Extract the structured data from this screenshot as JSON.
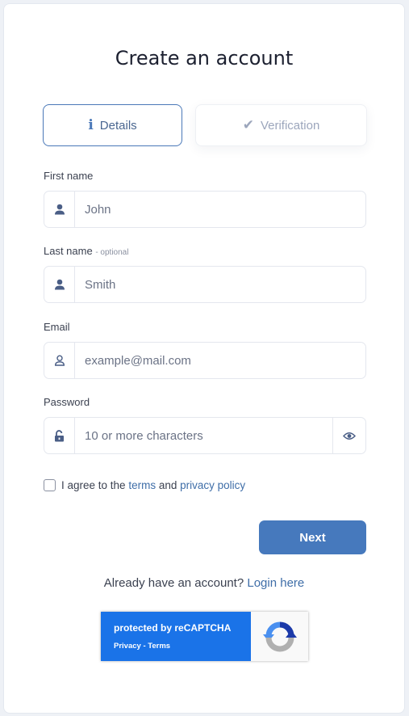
{
  "page": {
    "title": "Create an account"
  },
  "tabs": [
    {
      "label": "Details",
      "icon": "info-icon",
      "active": true
    },
    {
      "label": "Verification",
      "icon": "check-icon",
      "active": false
    }
  ],
  "form": {
    "first_name": {
      "label": "First name",
      "value": "John",
      "icon": "user-icon"
    },
    "last_name": {
      "label": "Last name",
      "optional_tag": "- optional",
      "value": "Smith",
      "icon": "user-icon"
    },
    "email": {
      "label": "Email",
      "placeholder": "example@mail.com",
      "value": "",
      "icon": "user-outline-icon"
    },
    "password": {
      "label": "Password",
      "placeholder": "10 or more characters",
      "value": "",
      "icon": "unlock-icon",
      "toggle_icon": "eye-icon"
    },
    "agree": {
      "checked": false,
      "prefix": "I agree to the",
      "terms_link": "terms",
      "and": "and",
      "privacy_link": "privacy policy"
    },
    "next_label": "Next"
  },
  "footer": {
    "prompt": "Already have an account?",
    "login_link": "Login here"
  },
  "recaptcha": {
    "line1": "protected by reCAPTCHA",
    "line2": "Privacy - Terms"
  },
  "colors": {
    "accent": "#4679bd",
    "link": "#3f6ea8",
    "recaptcha_blue": "#1a73e8",
    "background": "#eef1f6"
  }
}
